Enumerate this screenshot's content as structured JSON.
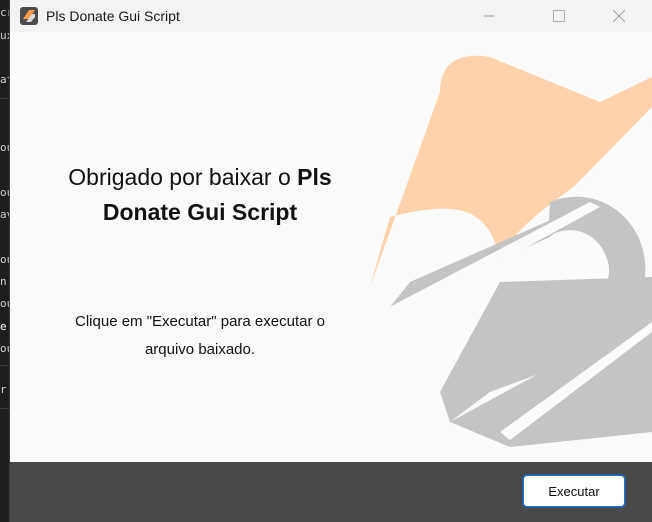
{
  "window": {
    "title": "Pls Donate Gui Script",
    "icon": "app-logo-icon",
    "controls": [
      "minimize-icon",
      "maximize-icon",
      "close-icon"
    ]
  },
  "main": {
    "heading_prefix": "Obrigado por baixar o ",
    "heading_bold_1": "Pls",
    "heading_bold_2": "Donate Gui Script",
    "description_line1": "Clique em \"Executar\" para executar o",
    "description_line2": "arquivo baixado."
  },
  "footer": {
    "execute_label": "Executar"
  },
  "background": {
    "lines": [
      "cr",
      "ux",
      "at",
      "ou",
      "ou",
      "av",
      "ou",
      "n",
      "ou",
      "e",
      "ou",
      "r"
    ]
  },
  "colors": {
    "accent_orange": "#ffd2ab",
    "accent_gray": "#c4c4c4",
    "footer": "#494949",
    "button_border": "#2f6fb1"
  }
}
